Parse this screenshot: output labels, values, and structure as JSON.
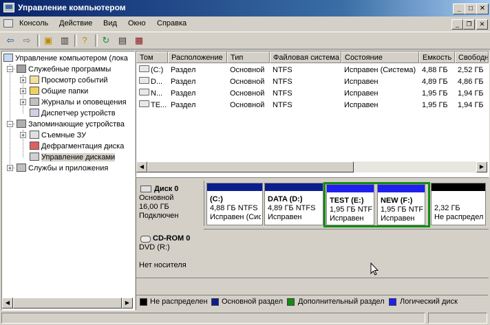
{
  "window": {
    "title": "Управление компьютером"
  },
  "menu": [
    "Консоль",
    "Действие",
    "Вид",
    "Окно",
    "Справка"
  ],
  "toolbar_icons": [
    "back-arrow-icon",
    "forward-arrow-icon",
    "up-folder-icon",
    "show-hide-tree-icon",
    "help-icon",
    "refresh-icon",
    "properties-icon",
    "disk-settings-icon"
  ],
  "tree": {
    "root": "Управление компьютером (лока",
    "utilities": "Служебные программы",
    "event_viewer": "Просмотр событий",
    "shared_folders": "Общие папки",
    "logs_alerts": "Журналы и оповещения",
    "device_manager": "Диспетчер устройств",
    "storage": "Запоминающие устройства",
    "removable": "Съемные ЗУ",
    "defrag": "Дефрагментация диска",
    "disk_mgmt": "Управление дисками",
    "services_apps": "Службы и приложения"
  },
  "volumes": {
    "columns": [
      "Том",
      "Расположение",
      "Тип",
      "Файловая система",
      "Состояние",
      "Емкость",
      "Свободно"
    ],
    "rows": [
      [
        "(C:)",
        "Раздел",
        "Основной",
        "NTFS",
        "Исправен (Система)",
        "4,88 ГБ",
        "2,52 ГБ"
      ],
      [
        "D...",
        "Раздел",
        "Основной",
        "NTFS",
        "Исправен",
        "4,89 ГБ",
        "4,86 ГБ"
      ],
      [
        "N...",
        "Раздел",
        "Основной",
        "NTFS",
        "Исправен",
        "1,95 ГБ",
        "1,94 ГБ"
      ],
      [
        "TE...",
        "Раздел",
        "Основной",
        "NTFS",
        "Исправен",
        "1,95 ГБ",
        "1,94 ГБ"
      ]
    ]
  },
  "disk0": {
    "name": "Диск 0",
    "type": "Основной",
    "size": "16,00 ГБ",
    "status": "Подключен",
    "partitions": [
      {
        "title": "(C:)",
        "size": "4,88 ГБ NTFS",
        "state": "Исправен (Сис",
        "color": "#0a1e8c"
      },
      {
        "title": "DATA (D:)",
        "size": "4,89 ГБ NTFS",
        "state": "Исправен",
        "color": "#0a1e8c"
      },
      {
        "title": "TEST (E:)",
        "size": "1,95 ГБ NTF",
        "state": "Исправен",
        "color": "#1f1ff0"
      },
      {
        "title": "NEW (F:)",
        "size": "1,95 ГБ NTF",
        "state": "Исправен",
        "color": "#1f1ff0"
      },
      {
        "title": "",
        "size": "2,32 ГБ",
        "state": "Не распредел",
        "color": "#000000"
      }
    ]
  },
  "cdrom0": {
    "name": "CD-ROM 0",
    "type": "DVD (R:)",
    "status": "Нет носителя"
  },
  "legend": [
    {
      "label": "Не распределен",
      "color": "#000000"
    },
    {
      "label": "Основной раздел",
      "color": "#0a1e8c"
    },
    {
      "label": "Дополнительный раздел",
      "color": "#128c12"
    },
    {
      "label": "Логический диск",
      "color": "#1f1ff0"
    }
  ],
  "extended_frame_color": "#128c12"
}
